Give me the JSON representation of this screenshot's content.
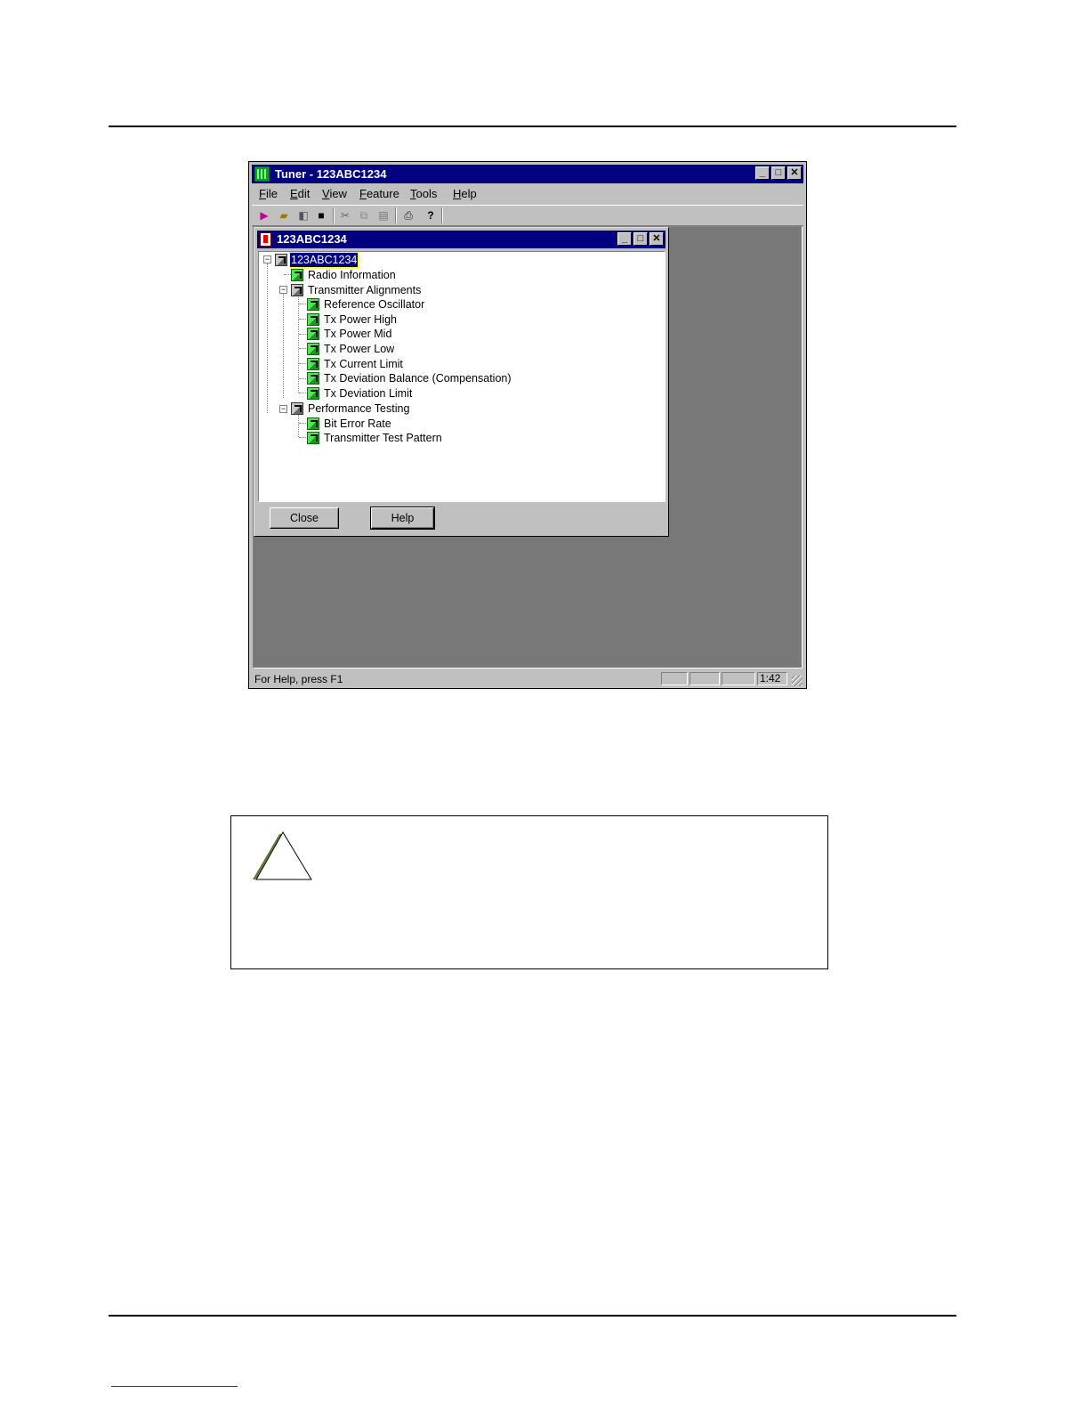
{
  "app": {
    "title": "Tuner - 123ABC1234",
    "menu": [
      "File",
      "Edit",
      "View",
      "Feature",
      "Tools",
      "Help"
    ],
    "status": {
      "text": "For Help, press F1",
      "clock": "1:42"
    }
  },
  "child": {
    "title": "123ABC1234",
    "tree": {
      "root": "123ABC1234",
      "radio_information": "Radio Information",
      "transmitter_alignments": "Transmitter Alignments",
      "tx_items": [
        "Reference Oscillator",
        "Tx Power High",
        "Tx Power Mid",
        "Tx Power Low",
        "Tx Current Limit",
        "Tx Deviation Balance (Compensation)",
        "Tx Deviation Limit"
      ],
      "performance_testing": "Performance Testing",
      "perf_items": [
        "Bit Error Rate",
        "Transmitter Test Pattern"
      ]
    },
    "buttons": {
      "close": "Close",
      "help": "Help"
    }
  },
  "icons": {
    "app": "tuner-app-icon",
    "child": "radio-document-icon",
    "node_leaf": "green-alignment-icon",
    "node_group": "gray-folder-alignment-icon",
    "caution": "caution-triangle-icon"
  },
  "colors": {
    "titlebar": "#000080",
    "workspace": "#787878",
    "chrome": "#c0c0c0",
    "leaf": "#3cd63c"
  }
}
